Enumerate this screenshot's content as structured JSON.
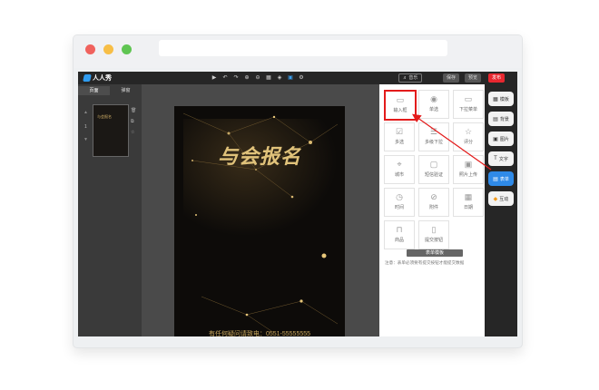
{
  "topbar": {
    "brand": "人人秀",
    "music_label": "♬ 音乐",
    "save_label": "保存",
    "preview_label": "预览",
    "publish_label": "发布",
    "tools": [
      "play-icon",
      "undo-icon",
      "redo-icon",
      "zoom-in-icon",
      "zoom-out-icon",
      "grid-icon",
      "layers-icon",
      "image-icon",
      "settings-icon"
    ]
  },
  "left": {
    "tabs": [
      "页面",
      "弹窗"
    ],
    "page_number": "1",
    "thumb_title": "与会报名"
  },
  "canvas": {
    "title": "与会报名",
    "contact": "有任何疑问请致电：0551-55555555"
  },
  "form_components": [
    {
      "label": "输入框",
      "icon": "input-box-icon"
    },
    {
      "label": "单选",
      "icon": "radio-icon"
    },
    {
      "label": "下拉菜单",
      "icon": "dropdown-icon"
    },
    {
      "label": "多选",
      "icon": "checkbox-icon"
    },
    {
      "label": "多级下拉",
      "icon": "multi-dropdown-icon"
    },
    {
      "label": "评分",
      "icon": "star-icon"
    },
    {
      "label": "城市",
      "icon": "location-icon"
    },
    {
      "label": "短信验证",
      "icon": "sms-icon"
    },
    {
      "label": "照片上传",
      "icon": "photo-upload-icon"
    },
    {
      "label": "时间",
      "icon": "clock-icon"
    },
    {
      "label": "附件",
      "icon": "paperclip-icon"
    },
    {
      "label": "日期",
      "icon": "calendar-icon"
    },
    {
      "label": "商品",
      "icon": "shopping-bag-icon"
    },
    {
      "label": "提交按钮",
      "icon": "submit-icon"
    }
  ],
  "library_button": "表单模板",
  "note": "注意：表单必须要有提交按钮才能提交数据",
  "rail": [
    {
      "label": "模板",
      "icon": "template-icon"
    },
    {
      "label": "背景",
      "icon": "background-icon"
    },
    {
      "label": "图片",
      "icon": "picture-icon"
    },
    {
      "label": "文字",
      "icon": "text-icon"
    },
    {
      "label": "表单",
      "icon": "form-icon"
    },
    {
      "label": "互动",
      "icon": "interact-icon"
    }
  ],
  "colors": {
    "accent": "#2f8ae8",
    "publish": "#e8272f",
    "highlight": "#e31b1b",
    "gold": "#e0c27a"
  }
}
